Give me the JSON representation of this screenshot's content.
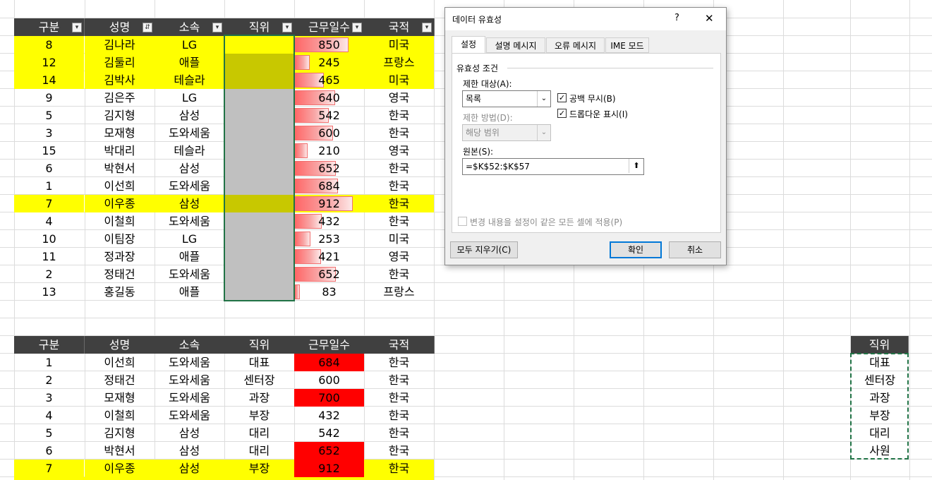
{
  "table1": {
    "headers": [
      "구분",
      "성명",
      "소속",
      "직위",
      "근무일수",
      "국적"
    ],
    "rows": [
      {
        "n": "8",
        "name": "김나라",
        "org": "LG",
        "days": "850",
        "dv": 850,
        "nat": "미국",
        "hl": true
      },
      {
        "n": "12",
        "name": "김둘리",
        "org": "애플",
        "days": "245",
        "dv": 245,
        "nat": "프랑스",
        "hl": true
      },
      {
        "n": "14",
        "name": "김박사",
        "org": "테슬라",
        "days": "465",
        "dv": 465,
        "nat": "미국",
        "hl": true
      },
      {
        "n": "9",
        "name": "김은주",
        "org": "LG",
        "days": "640",
        "dv": 640,
        "nat": "영국",
        "hl": false
      },
      {
        "n": "5",
        "name": "김지형",
        "org": "삼성",
        "days": "542",
        "dv": 542,
        "nat": "한국",
        "hl": false
      },
      {
        "n": "3",
        "name": "모재형",
        "org": "도와세움",
        "days": "600",
        "dv": 600,
        "nat": "한국",
        "hl": false
      },
      {
        "n": "15",
        "name": "박대리",
        "org": "테슬라",
        "days": "210",
        "dv": 210,
        "nat": "영국",
        "hl": false
      },
      {
        "n": "6",
        "name": "박현서",
        "org": "삼성",
        "days": "652",
        "dv": 652,
        "nat": "한국",
        "hl": false
      },
      {
        "n": "1",
        "name": "이선희",
        "org": "도와세움",
        "days": "684",
        "dv": 684,
        "nat": "한국",
        "hl": false
      },
      {
        "n": "7",
        "name": "이우종",
        "org": "삼성",
        "days": "912",
        "dv": 912,
        "nat": "한국",
        "hl": true
      },
      {
        "n": "4",
        "name": "이철희",
        "org": "도와세움",
        "days": "432",
        "dv": 432,
        "nat": "한국",
        "hl": false
      },
      {
        "n": "10",
        "name": "이팀장",
        "org": "LG",
        "days": "253",
        "dv": 253,
        "nat": "미국",
        "hl": false
      },
      {
        "n": "11",
        "name": "정과장",
        "org": "애플",
        "days": "421",
        "dv": 421,
        "nat": "영국",
        "hl": false
      },
      {
        "n": "2",
        "name": "정태건",
        "org": "도와세움",
        "days": "652",
        "dv": 652,
        "nat": "한국",
        "hl": false
      },
      {
        "n": "13",
        "name": "홍길동",
        "org": "애플",
        "days": "83",
        "dv": 83,
        "nat": "프랑스",
        "hl": false
      }
    ]
  },
  "table2": {
    "headers": [
      "구분",
      "성명",
      "소속",
      "직위",
      "근무일수",
      "국적"
    ],
    "rows": [
      {
        "n": "1",
        "name": "이선희",
        "org": "도와세움",
        "pos": "대표",
        "days": "684",
        "red": true,
        "hl": false
      },
      {
        "n": "2",
        "name": "정태건",
        "org": "도와세움",
        "pos": "센터장",
        "days": "600",
        "red": false,
        "hl": false
      },
      {
        "n": "3",
        "name": "모재형",
        "org": "도와세움",
        "pos": "과장",
        "days": "700",
        "red": true,
        "hl": false
      },
      {
        "n": "4",
        "name": "이철희",
        "org": "도와세움",
        "pos": "부장",
        "days": "432",
        "red": false,
        "hl": false
      },
      {
        "n": "5",
        "name": "김지형",
        "org": "삼성",
        "pos": "대리",
        "days": "542",
        "red": false,
        "hl": false
      },
      {
        "n": "6",
        "name": "박현서",
        "org": "삼성",
        "pos": "대리",
        "days": "652",
        "red": true,
        "hl": false
      },
      {
        "n": "7",
        "name": "이우종",
        "org": "삼성",
        "pos": "부장",
        "days": "912",
        "red": true,
        "hl": true
      }
    ],
    "nat": [
      "한국",
      "한국",
      "한국",
      "한국",
      "한국",
      "한국",
      "한국"
    ]
  },
  "poslist": {
    "header": "직위",
    "items": [
      "대표",
      "센터장",
      "과장",
      "부장",
      "대리",
      "사원"
    ]
  },
  "dialog": {
    "title": "데이터 유효성",
    "help": "?",
    "close": "✕",
    "tabs": [
      "설정",
      "설명 메시지",
      "오류 메시지",
      "IME 모드"
    ],
    "group": "유효성 조건",
    "allow_label": "제한 대상(A):",
    "allow_value": "목록",
    "ignore_blank": "공백 무시(B)",
    "dropdown": "드롭다운 표시(I)",
    "data_label": "제한 방법(D):",
    "data_value": "해당 범위",
    "source_label": "원본(S):",
    "source_value": "=$K$52:$K$57",
    "apply_all": "변경 내용을 설정이 같은 모든 셀에 적용(P)",
    "clear_all": "모두 지우기(C)",
    "ok": "확인",
    "cancel": "취소"
  },
  "colors": {
    "header": "#404040",
    "highlight": "#ffff00",
    "olive": "#c8c800",
    "gray": "#c0c0c0",
    "red": "#ff0000",
    "select": "#217346"
  }
}
